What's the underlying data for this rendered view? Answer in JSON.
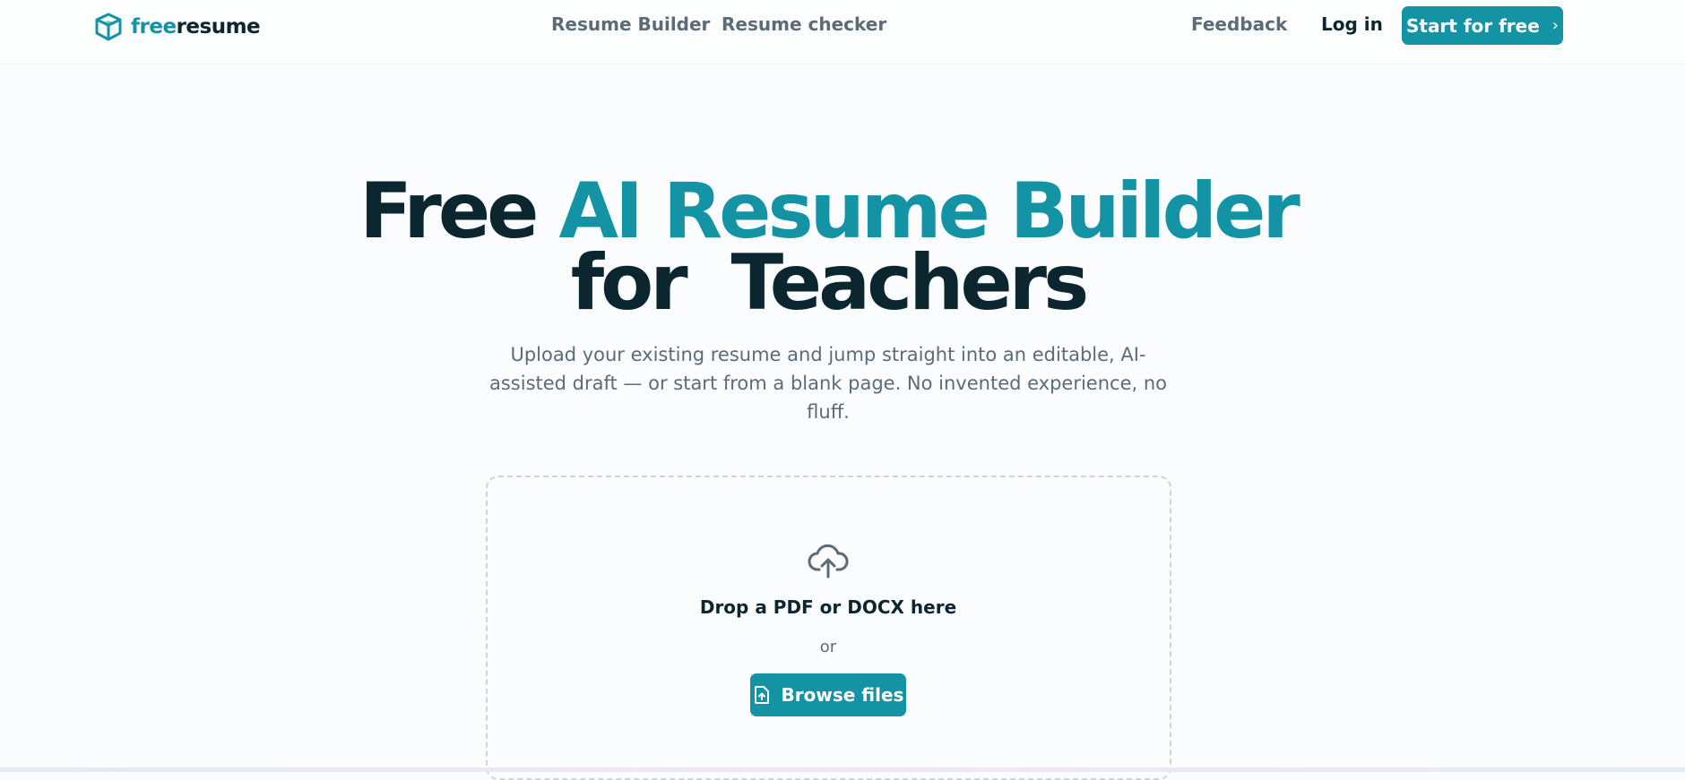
{
  "header": {
    "logo": {
      "icon": "box-logo-icon",
      "text_free": "free",
      "text_resume": "resume"
    },
    "nav": [
      {
        "label": "Resume Builder"
      },
      {
        "label": "Resume checker"
      }
    ],
    "feedback_label": "Feedback",
    "login_label": "Log in",
    "cta": {
      "label": "Start for free",
      "icon": "chevron-right-icon",
      "glyph": "›"
    }
  },
  "hero": {
    "line1_prefix": "Free",
    "line1_accent": "AI Resume Builder",
    "line2": "for  Teachers",
    "subtitle": "Upload your existing resume and jump straight into an editable, AI-assisted draft — or start from a blank page. No invented experience, no fluff."
  },
  "upload": {
    "icon": "cloud-upload-icon",
    "title": "Drop a PDF or DOCX here",
    "or_label": "or",
    "browse_label": "Browse files",
    "browse_icon": "file-upload-icon"
  },
  "colors": {
    "accent": "#1493a4",
    "dark": "#0c2630",
    "muted": "#5b6b78"
  }
}
